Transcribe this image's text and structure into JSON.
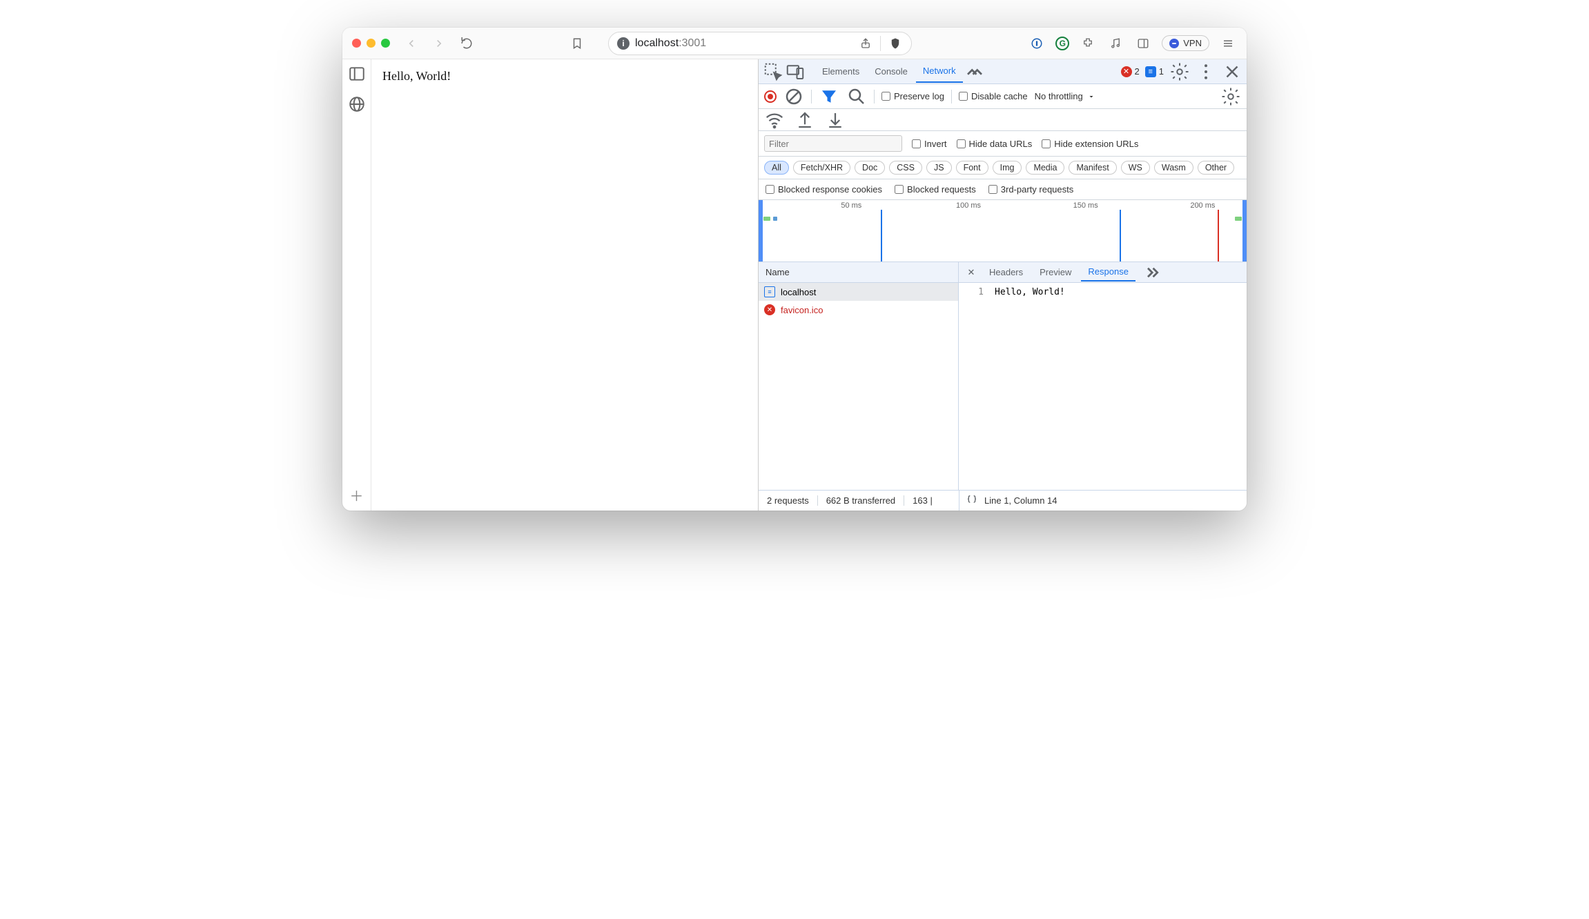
{
  "toolbar": {
    "url_host": "localhost",
    "url_port": ":3001",
    "vpn_label": "VPN"
  },
  "page": {
    "content": "Hello, World!"
  },
  "devtools": {
    "tabs": {
      "elements": "Elements",
      "console": "Console",
      "network": "Network"
    },
    "errors_count": "2",
    "messages_count": "1",
    "net": {
      "preserve_log": "Preserve log",
      "disable_cache": "Disable cache",
      "throttling": "No throttling",
      "filter_placeholder": "Filter",
      "invert": "Invert",
      "hide_data_urls": "Hide data URLs",
      "hide_ext_urls": "Hide extension URLs",
      "chips": {
        "all": "All",
        "fetch": "Fetch/XHR",
        "doc": "Doc",
        "css": "CSS",
        "js": "JS",
        "font": "Font",
        "img": "Img",
        "media": "Media",
        "manifest": "Manifest",
        "ws": "WS",
        "wasm": "Wasm",
        "other": "Other"
      },
      "blocked_cookies": "Blocked response cookies",
      "blocked_requests": "Blocked requests",
      "third_party": "3rd-party requests",
      "timeline_ticks": [
        "50 ms",
        "100 ms",
        "150 ms",
        "200 ms"
      ],
      "name_header": "Name",
      "requests": [
        {
          "name": "localhost",
          "status": "ok"
        },
        {
          "name": "favicon.ico",
          "status": "error"
        }
      ],
      "detail_tabs": {
        "headers": "Headers",
        "preview": "Preview",
        "response": "Response"
      },
      "response_lines": [
        {
          "n": "1",
          "text": "Hello, World!"
        }
      ],
      "status": {
        "requests": "2 requests",
        "transferred": "662 B transferred",
        "truncated": "163 |",
        "cursor": "Line 1, Column 14"
      }
    }
  }
}
